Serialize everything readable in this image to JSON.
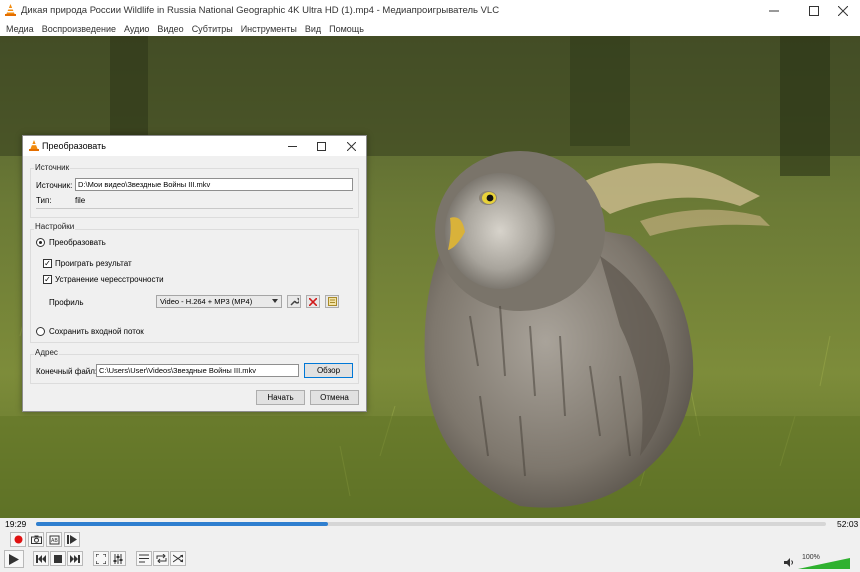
{
  "window": {
    "title": "Дикая природа России   Wildlife in Russia   National Geographic 4K Ultra HD (1).mp4 - Медиапроигрыватель VLC"
  },
  "menu": [
    "Медиа",
    "Воспроизведение",
    "Аудио",
    "Видео",
    "Субтитры",
    "Инструменты",
    "Вид",
    "Помощь"
  ],
  "playback": {
    "current_time": "19:29",
    "total_time": "52:03",
    "progress": 0.37,
    "volume_label": "100%",
    "volume_level": 1.0
  },
  "dialog": {
    "title": "Преобразовать",
    "source": {
      "group_label": "Источник",
      "source_label": "Источник:",
      "source_value": "D:\\Мои видео\\Звездные Войны III.mkv",
      "type_label": "Тип:",
      "type_value": "file"
    },
    "settings": {
      "group_label": "Настройки",
      "convert_label": "Преобразовать",
      "play_result_label": "Проиграть результат",
      "deinterlace_label": "Устранение чересстрочности",
      "profile_label": "Профиль",
      "profile_value": "Video - H.264 + MP3 (MP4)",
      "keep_stream_label": "Сохранить входной поток"
    },
    "destination": {
      "group_label": "Адрес",
      "file_label": "Конечный файл:",
      "file_value": "C:\\Users\\User\\Videos\\Звездные Войны III.mkv",
      "browse_label": "Обзор"
    },
    "start_label": "Начать",
    "cancel_label": "Отмена"
  },
  "colors": {
    "accent": "#2f7fcf",
    "record": "#e01010",
    "delete_profile": "#d11a1a"
  }
}
